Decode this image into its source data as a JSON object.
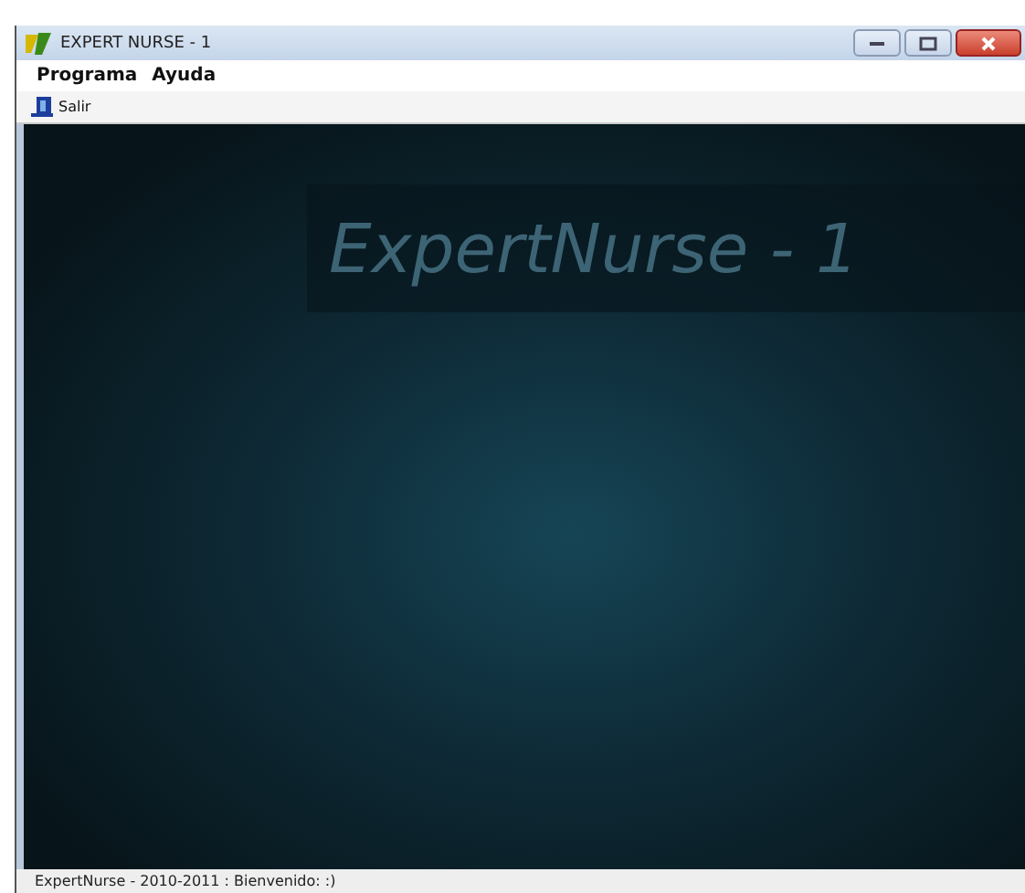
{
  "window": {
    "title": "EXPERT NURSE - 1"
  },
  "menu": [
    {
      "label": "Programa"
    },
    {
      "label": "Ayuda"
    }
  ],
  "toolbar": [
    {
      "label": "Salir"
    }
  ],
  "banner": {
    "title": "ExpertNurse - 1"
  },
  "status_bar": "ExpertNurse - 2010-2011 : Bienvenido: :)"
}
